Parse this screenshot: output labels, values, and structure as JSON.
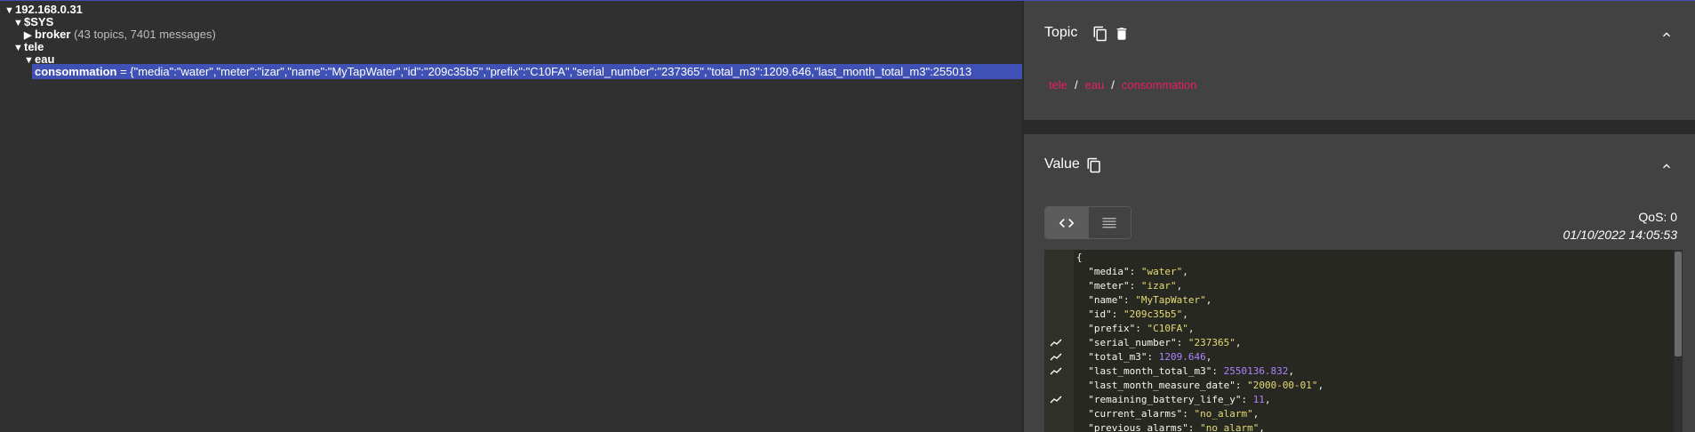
{
  "tree": {
    "root": {
      "label": "192.168.0.31"
    },
    "sys": {
      "label": "$SYS"
    },
    "broker": {
      "label": "broker",
      "meta": "(43 topics, 7401 messages)"
    },
    "tele": {
      "label": "tele"
    },
    "eau": {
      "label": "eau"
    },
    "selected": {
      "topic": "consommation",
      "eq": " = ",
      "payload": "{\"media\":\"water\",\"meter\":\"izar\",\"name\":\"MyTapWater\",\"id\":\"209c35b5\",\"prefix\":\"C10FA\",\"serial_number\":\"237365\",\"total_m3\":1209.646,\"last_month_total_m3\":255013"
    }
  },
  "topic_card": {
    "title": "Topic",
    "crumbs": [
      "tele",
      "eau",
      "consommation"
    ],
    "separator": "/"
  },
  "value_card": {
    "title": "Value",
    "qos": "QoS: 0",
    "timestamp": "01/10/2022 14:05:53",
    "json_lines": [
      {
        "t": "{",
        "g": false
      },
      {
        "key": "\"media\"",
        "val": "\"water\"",
        "type": "s",
        "g": false
      },
      {
        "key": "\"meter\"",
        "val": "\"izar\"",
        "type": "s",
        "g": false
      },
      {
        "key": "\"name\"",
        "val": "\"MyTapWater\"",
        "type": "s",
        "g": false
      },
      {
        "key": "\"id\"",
        "val": "\"209c35b5\"",
        "type": "s",
        "g": false
      },
      {
        "key": "\"prefix\"",
        "val": "\"C10FA\"",
        "type": "s",
        "g": false
      },
      {
        "key": "\"serial_number\"",
        "val": "\"237365\"",
        "type": "s",
        "g": true
      },
      {
        "key": "\"total_m3\"",
        "val": "1209.646",
        "type": "n",
        "g": true
      },
      {
        "key": "\"last_month_total_m3\"",
        "val": "2550136.832",
        "type": "n",
        "g": true
      },
      {
        "key": "\"last_month_measure_date\"",
        "val": "\"2000-00-01\"",
        "type": "s",
        "g": false
      },
      {
        "key": "\"remaining_battery_life_y\"",
        "val": "11",
        "type": "n",
        "g": true
      },
      {
        "key": "\"current_alarms\"",
        "val": "\"no_alarm\"",
        "type": "s",
        "g": false
      },
      {
        "key": "\"previous_alarms\"",
        "val": "\"no_alarm\"",
        "type": "s",
        "g": false
      }
    ]
  },
  "icons": {
    "copy": "copy-icon",
    "delete": "trash-icon",
    "collapse": "chevron-up-icon",
    "raw": "code-icon",
    "list": "list-icon",
    "chart": "chart-icon"
  },
  "colors": {
    "accent": "#3f51b5",
    "crumb": "#e91e63",
    "editor_bg": "#272822",
    "string": "#e6db74",
    "number": "#ae81ff"
  }
}
